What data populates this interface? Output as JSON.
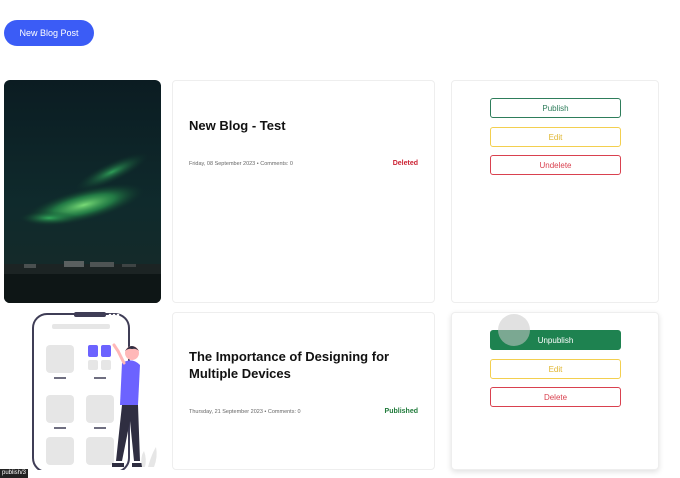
{
  "toolbar": {
    "new_post_label": "New Blog Post"
  },
  "posts": [
    {
      "title": "New Blog - Test",
      "meta": "Friday, 08 September 2023  •  Comments: 0",
      "status": "Deleted",
      "actions": [
        "Publish",
        "Edit",
        "Undelete"
      ]
    },
    {
      "title": "The Importance of Designing for Multiple Devices",
      "meta": "Thursday, 21 September 2023  •  Comments: 0",
      "status": "Published",
      "actions": [
        "Unpublish",
        "Edit",
        "Delete"
      ]
    }
  ],
  "statusbar": {
    "url": "publish/3"
  },
  "colors": {
    "primary": "#3b5cf6",
    "deleted": "#cc2233",
    "published": "#1f7a3a",
    "publish_outline": "#2e7d5b",
    "edit_outline": "#f3cf4f",
    "danger_outline": "#d9414f",
    "unpublish_fill": "#1e8250"
  }
}
